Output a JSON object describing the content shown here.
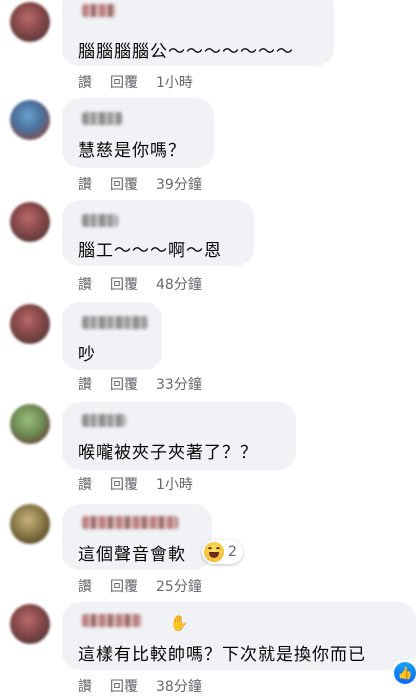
{
  "actions": {
    "like": "讚",
    "reply": "回覆"
  },
  "comments": [
    {
      "text": "腦腦腦腦公～～～～～～～",
      "time": "1小時"
    },
    {
      "text": "慧慈是你嗎？",
      "time": "39分鐘"
    },
    {
      "text": "腦工～～～啊～恩",
      "time": "48分鐘"
    },
    {
      "text": "吵",
      "time": "33分鐘"
    },
    {
      "text": "喉嚨被夾子夾著了？？",
      "time": "1小時"
    },
    {
      "text": "這個聲音會軟",
      "time": "25分鐘",
      "reaction_count": "2",
      "reaction_icon": "haha-icon"
    },
    {
      "text": "這樣有比較帥嗎？下次就是換你而已",
      "time": "38分鐘",
      "badge_icon": "waving-hand-icon"
    }
  ],
  "corner_badge": {
    "icon": "like-icon"
  }
}
